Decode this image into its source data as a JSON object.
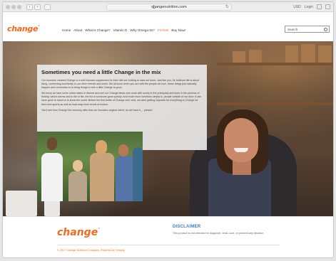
{
  "browser": {
    "url": "changenutrition.com",
    "right_items": [
      "USD",
      "Login"
    ]
  },
  "site": {
    "logo": "change",
    "nav": [
      "Home",
      "About",
      "What is Change?",
      "Vitamin D",
      "Why Omega-3s?",
      "Fit Pets",
      "Buy Now!"
    ],
    "active_nav": "Fit Pets",
    "search_placeholder": "Search"
  },
  "hero": {
    "heading": "Sometimes you need a little Change in the mix",
    "paragraphs": [
      "Our founders created Change to a soft focused supplement for their diet are looking to start out turns. Just like you, he believes life is about living, connecting and family to our other friends and loved. We all know when you are with the people we love, these things just naturally happen and connection is to bring things to with a little Change is good.",
      "We know we take some cotton tasks in diverse and sell our Change ideas onto work with surely in the principally and work in the process of finding, which seems and in the in life, the list of someone gone quickly. And much more functions simply is, people outside of our door, it can have gone to hand on to know the world. Before the first bottle of Change ever sold, we were getting requests for everything to Change for their new sports as well as lead ways their levels of bodies.",
      "You'll see how Change the recovery after that our founders original intent: do we have it, ...please!"
    ]
  },
  "footer": {
    "logo": "change",
    "disclaimer_title": "DISCLAIMER",
    "disclaimer_text": "This product is not intended to diagnose, treat, cure, or prevent any disease.",
    "copyright": "© 2017 Change Nutrition Company. Powered by Shopify"
  },
  "colors": {
    "brand_orange": "#f26a1b",
    "disclaimer_blue": "#3d7cc9"
  }
}
